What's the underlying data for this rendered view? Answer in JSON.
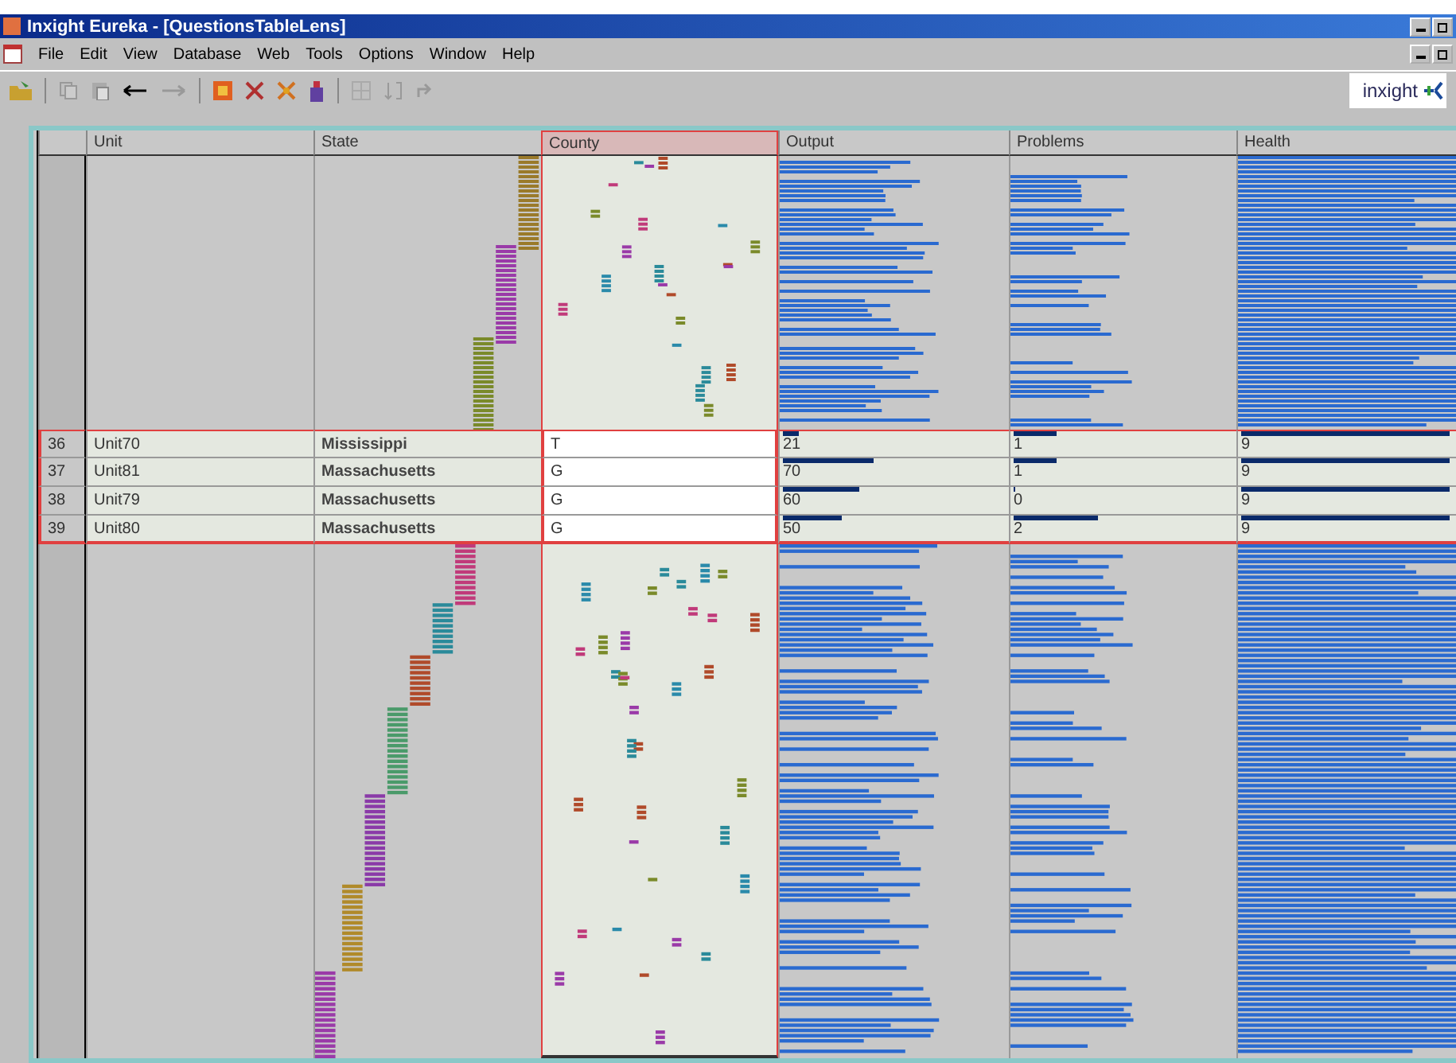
{
  "window": {
    "title": "Inxight Eureka - [QuestionsTableLens]"
  },
  "menu": [
    "File",
    "Edit",
    "View",
    "Database",
    "Web",
    "Tools",
    "Options",
    "Window",
    "Help"
  ],
  "logo": {
    "text": "inxight"
  },
  "table": {
    "columns": [
      {
        "label": "Unit",
        "selected": false
      },
      {
        "label": "State",
        "selected": false
      },
      {
        "label": "County",
        "selected": true
      },
      {
        "label": "Output",
        "selected": false
      },
      {
        "label": "Problems",
        "selected": false
      },
      {
        "label": "Health",
        "selected": false
      }
    ],
    "focus_rows": [
      {
        "number": "36",
        "unit": "Unit70",
        "state": "Mississippi",
        "county": "T",
        "output": {
          "text": "21",
          "level": 0.07
        },
        "problems": {
          "text": "1",
          "level": 0.2
        },
        "health": {
          "text": "9",
          "level": 1
        }
      },
      {
        "number": "37",
        "unit": "Unit81",
        "state": "Massachusetts",
        "county": "G",
        "output": {
          "text": "70",
          "level": 0.41
        },
        "problems": {
          "text": "1",
          "level": 0.2
        },
        "health": {
          "text": "9",
          "level": 1
        }
      },
      {
        "number": "38",
        "unit": "Unit79",
        "state": "Massachusetts",
        "county": "G",
        "output": {
          "text": "60",
          "level": 0.35
        },
        "problems": {
          "text": "0",
          "level": 0
        },
        "health": {
          "text": "9",
          "level": 1
        }
      },
      {
        "number": "39",
        "unit": "Unit80",
        "state": "Massachusetts",
        "county": "G",
        "output": {
          "text": "50",
          "level": 0.27
        },
        "problems": {
          "text": "2",
          "level": 0.39
        },
        "health": {
          "text": "9",
          "level": 1
        }
      }
    ]
  }
}
